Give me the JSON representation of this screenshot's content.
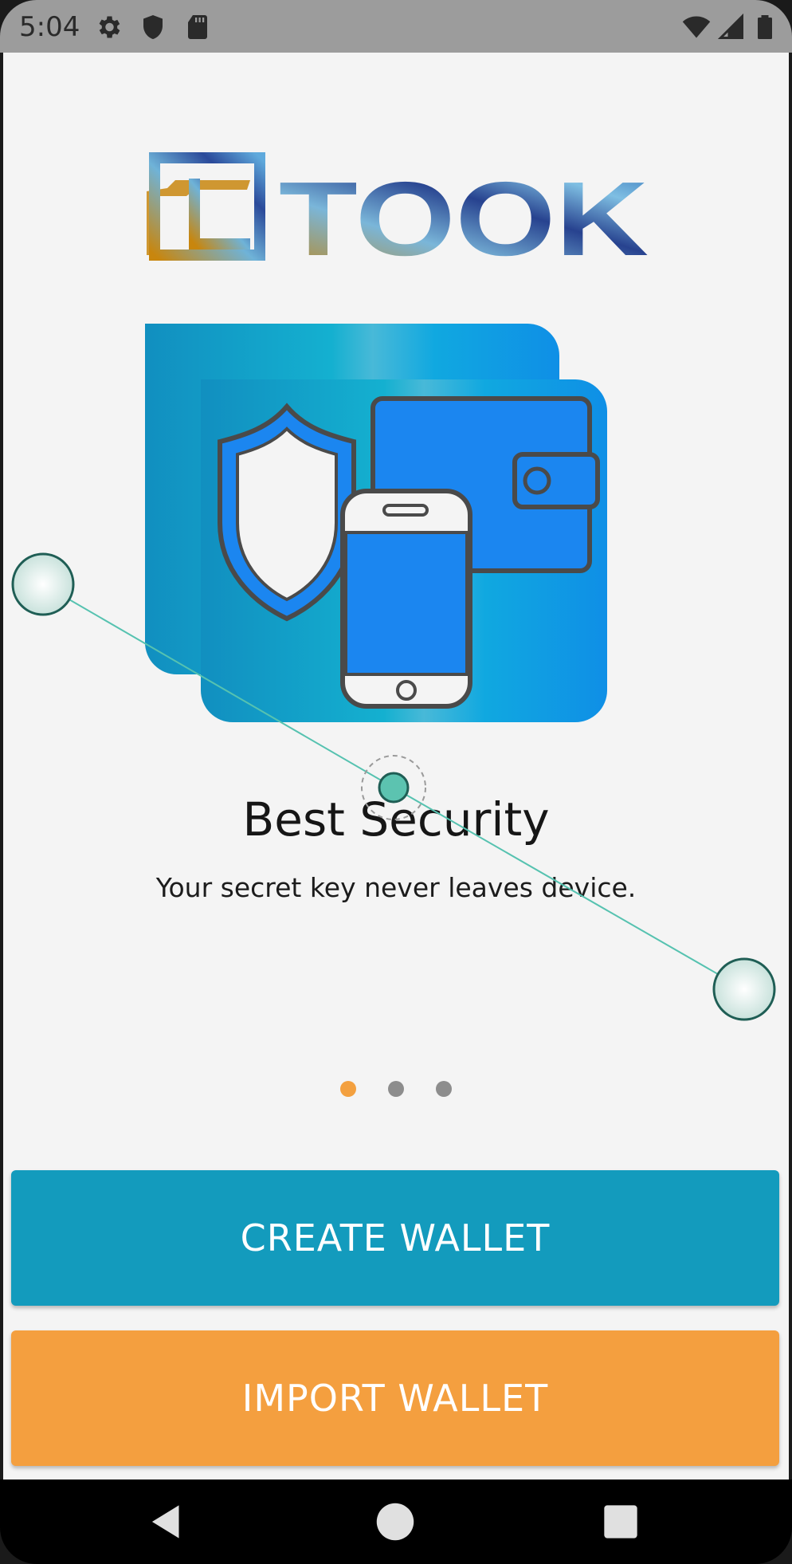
{
  "status_bar": {
    "time": "5:04",
    "left_icons": [
      "gear-icon",
      "shield-icon",
      "sd-card-icon"
    ],
    "right_icons": [
      "wifi-icon",
      "signal-icon",
      "battery-icon"
    ]
  },
  "app": {
    "logo_text": "TOOK",
    "slide": {
      "title": "Best Security",
      "subtitle": "Your secret key never leaves device."
    },
    "pager": {
      "count": 3,
      "active_index": 0
    },
    "buttons": {
      "create_label": "CREATE WALLET",
      "import_label": "IMPORT WALLET"
    }
  },
  "nav_bar": {
    "buttons": [
      "back-icon",
      "home-icon",
      "recents-icon"
    ]
  },
  "colors": {
    "primary": "#139bbd",
    "accent": "#f49f3f",
    "background": "#f4f4f4",
    "dot_inactive": "#8d8d8d"
  }
}
